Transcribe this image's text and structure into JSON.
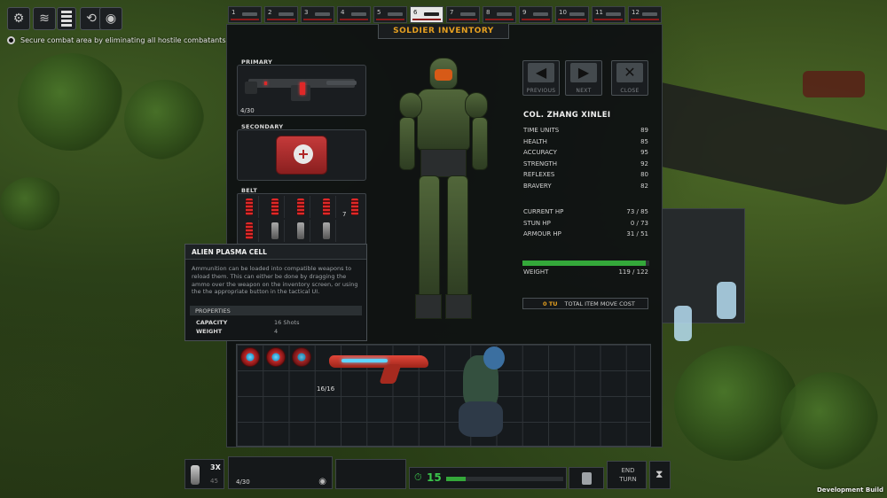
{
  "objective": {
    "text": "Secure combat area by eliminating all hostile combatants"
  },
  "tabs": [
    {
      "num": "1"
    },
    {
      "num": "2"
    },
    {
      "num": "3"
    },
    {
      "num": "4"
    },
    {
      "num": "5"
    },
    {
      "num": "6"
    },
    {
      "num": "7"
    },
    {
      "num": "8"
    },
    {
      "num": "9"
    },
    {
      "num": "10"
    },
    {
      "num": "11"
    },
    {
      "num": "12"
    }
  ],
  "active_tab": 6,
  "panel": {
    "title": "SOLDIER INVENTORY"
  },
  "slots": {
    "primary_label": "PRIMARY",
    "primary_ammo": "4/30",
    "secondary_label": "SECONDARY",
    "belt_label": "BELT",
    "belt_count": "7"
  },
  "nav": {
    "previous": "PREVIOUS",
    "next": "NEXT",
    "close": "CLOSE"
  },
  "soldier": {
    "name": "COL. ZHANG XINLEI",
    "stats": [
      {
        "label": "TIME UNITS",
        "value": "89"
      },
      {
        "label": "HEALTH",
        "value": "85"
      },
      {
        "label": "ACCURACY",
        "value": "95"
      },
      {
        "label": "STRENGTH",
        "value": "92"
      },
      {
        "label": "REFLEXES",
        "value": "80"
      },
      {
        "label": "BRAVERY",
        "value": "82"
      }
    ],
    "vitals": [
      {
        "label": "CURRENT HP",
        "value": "73 / 85"
      },
      {
        "label": "STUN HP",
        "value": "0 / 73"
      },
      {
        "label": "ARMOUR HP",
        "value": "31 / 51"
      }
    ],
    "weight_label": "WEIGHT",
    "weight_value": "119 / 122",
    "weight_fraction": 0.975,
    "move_cost_tu": "0 TU",
    "move_cost_label": "TOTAL ITEM MOVE COST"
  },
  "tooltip": {
    "title": "ALIEN PLASMA CELL",
    "description": "Ammunition can be loaded into compatible weapons to reload them. This can either be done by dragging the ammo over the weapon on the inventory screen, or using the the appropriate button in the tactical UI.",
    "properties_label": "PROPERTIES",
    "props": [
      {
        "key": "CAPACITY",
        "value": "16 Shots"
      },
      {
        "key": "WEIGHT",
        "value": "4"
      }
    ]
  },
  "grid": {
    "plasma_rifle_ammo": "16/16"
  },
  "hud": {
    "grenade_count": "3X",
    "grenade_sub": "45",
    "weapon_ammo": "4/30",
    "time_units": "15",
    "end_turn": "END TURN",
    "dev_build": "Development Build"
  },
  "colors": {
    "accent": "#e6a020",
    "health": "#34a83a",
    "alert": "#e02828"
  }
}
